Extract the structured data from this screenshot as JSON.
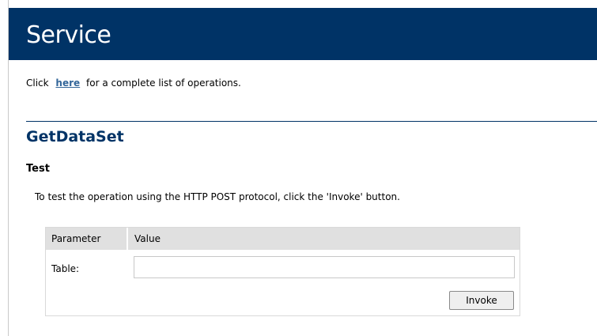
{
  "banner": {
    "title": "Service",
    "color": "#003366"
  },
  "intro": {
    "prefix": "Click",
    "link_label": "here",
    "suffix": "for a complete list of operations."
  },
  "operation": {
    "name": "GetDataSet"
  },
  "test": {
    "heading": "Test",
    "description": "To test the operation using the HTTP POST protocol, click the 'Invoke' button."
  },
  "params": {
    "header_parameter": "Parameter",
    "header_value": "Value",
    "rows": [
      {
        "label": "Table:",
        "value": ""
      }
    ],
    "invoke_label": "Invoke"
  },
  "colors": {
    "banner": "#003366",
    "link": "#336699",
    "heading": "#003366",
    "table_header": "#e0e0e0"
  }
}
